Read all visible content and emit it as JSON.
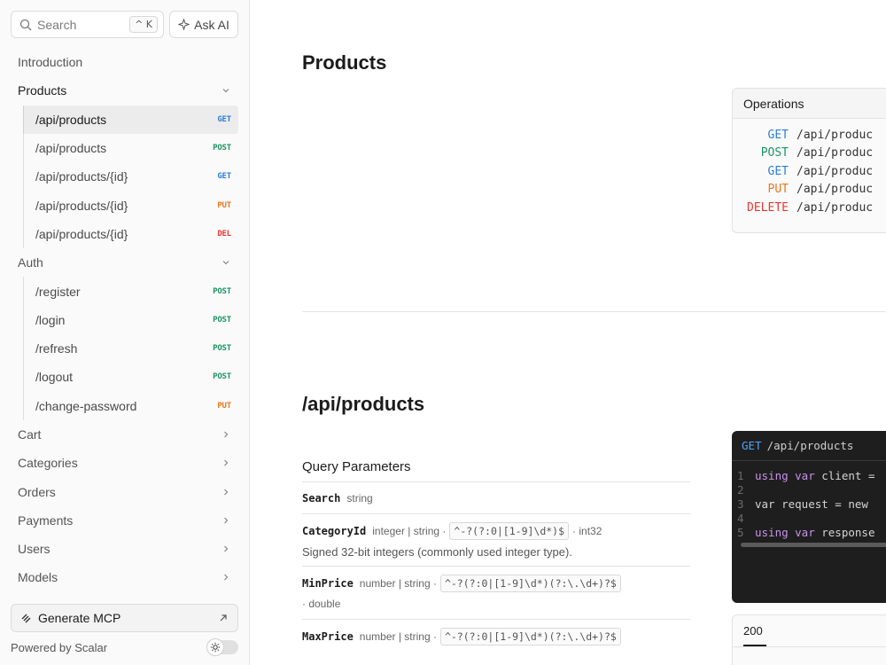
{
  "search": {
    "placeholder": "Search",
    "shortcut": "^ K"
  },
  "ask_ai": {
    "label": "Ask AI"
  },
  "nav": {
    "introduction": "Introduction",
    "products": {
      "label": "Products",
      "items": [
        {
          "path": "/api/products",
          "method": "GET"
        },
        {
          "path": "/api/products",
          "method": "POST"
        },
        {
          "path": "/api/products/{id}",
          "method": "GET"
        },
        {
          "path": "/api/products/{id}",
          "method": "PUT"
        },
        {
          "path": "/api/products/{id}",
          "method": "DEL"
        }
      ]
    },
    "auth": {
      "label": "Auth",
      "items": [
        {
          "path": "/register",
          "method": "POST"
        },
        {
          "path": "/login",
          "method": "POST"
        },
        {
          "path": "/refresh",
          "method": "POST"
        },
        {
          "path": "/logout",
          "method": "POST"
        },
        {
          "path": "/change-password",
          "method": "PUT"
        }
      ]
    },
    "sections": [
      "Cart",
      "Categories",
      "Orders",
      "Payments",
      "Users",
      "Models"
    ]
  },
  "footer": {
    "mcp_label": "Generate MCP",
    "powered_by": "Powered by Scalar"
  },
  "main": {
    "section_title": "Products",
    "operations": {
      "title": "Operations",
      "rows": [
        {
          "method": "GET",
          "path": "/api/produc"
        },
        {
          "method": "POST",
          "path": "/api/produc"
        },
        {
          "method": "GET",
          "path": "/api/produc"
        },
        {
          "method": "PUT",
          "path": "/api/produc"
        },
        {
          "method": "DELETE",
          "path": "/api/produc"
        }
      ]
    },
    "endpoint_title": "/api/products",
    "query_params": {
      "title": "Query Parameters",
      "params": [
        {
          "name": "Search",
          "type": "string",
          "pattern": "",
          "format": "",
          "description": ""
        },
        {
          "name": "CategoryId",
          "type": "integer | string ·",
          "pattern": "^-?(?:0|[1-9]\\d*)$",
          "format": "· int32",
          "description": "Signed 32-bit integers (commonly used integer type)."
        },
        {
          "name": "MinPrice",
          "type": "number | string ·",
          "pattern": "^-?(?:0|[1-9]\\d*)(?:\\.\\d+)?$",
          "format": "· double",
          "description": ""
        },
        {
          "name": "MaxPrice",
          "type": "number | string ·",
          "pattern": "^-?(?:0|[1-9]\\d*)(?:\\.\\d+)?$",
          "format": "",
          "description": ""
        }
      ]
    },
    "code": {
      "method": "GET",
      "path": "/api/products",
      "lines": [
        {
          "n": "1",
          "kw": "using var",
          "rest": " client ="
        },
        {
          "n": "2",
          "kw": "",
          "rest": ""
        },
        {
          "n": "3",
          "kw": "",
          "rest": "var request = new"
        },
        {
          "n": "4",
          "kw": "",
          "rest": ""
        },
        {
          "n": "5",
          "kw": "using var",
          "rest": " response"
        }
      ]
    },
    "response": {
      "status": "200"
    }
  },
  "colors": {
    "get": "#2d7fd6",
    "post": "#1c9462",
    "put": "#e8761b",
    "delete": "#e53935"
  }
}
